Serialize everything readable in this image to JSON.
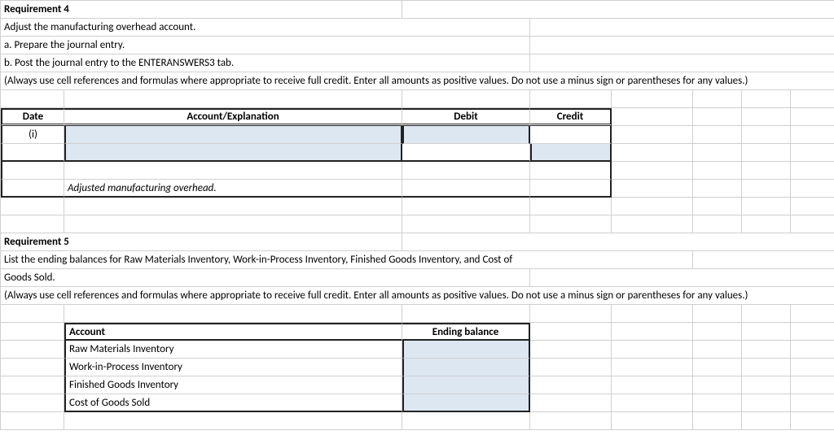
{
  "req4": {
    "title": "Requirement 4",
    "line1": "Adjust the manufacturing overhead account.",
    "line2": "a.  Prepare the journal entry.",
    "line3": "b.  Post the journal entry to the ENTERANSWERS3 tab.",
    "note": "(Always use cell references and formulas where appropriate to receive full credit. Enter all amounts as positive values. Do not use a minus sign or parentheses for any values.)",
    "headers": {
      "date": "Date",
      "account": "Account/Explanation",
      "debit": "Debit",
      "credit": "Credit"
    },
    "mark": "(i)",
    "explanation": "Adjusted manufacturing overhead."
  },
  "req5": {
    "title": "Requirement 5",
    "desc_line1": "List the ending balances for Raw Materials Inventory, Work-in-Process Inventory, Finished Goods Inventory, and Cost of",
    "desc_line2": "Goods Sold.",
    "note": "(Always use cell references and formulas where appropriate to receive full credit. Enter all amounts as positive values. Do not use a minus sign or parentheses for any values.)",
    "headers": {
      "account": "Account",
      "ending": "Ending balance"
    },
    "rows": [
      "Raw Materials Inventory",
      "Work-in-Process Inventory",
      "Finished Goods Inventory",
      "Cost of Goods Sold"
    ]
  }
}
